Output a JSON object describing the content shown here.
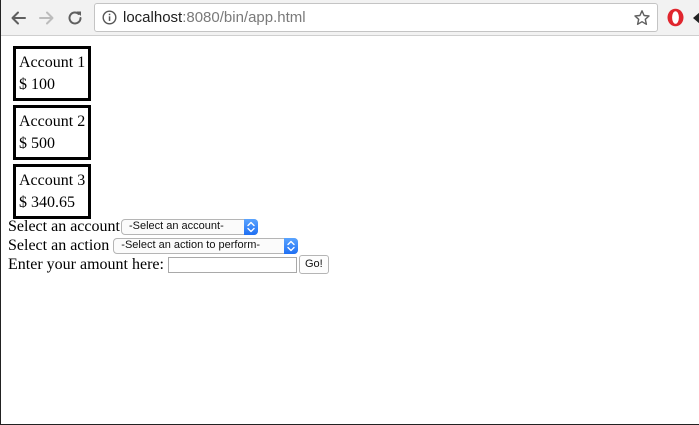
{
  "browser": {
    "url_host": "localhost",
    "url_rest": ":8080/bin/app.html"
  },
  "accounts": [
    {
      "name": "Account 1",
      "balance": "$ 100"
    },
    {
      "name": "Account 2",
      "balance": "$ 500"
    },
    {
      "name": "Account 3",
      "balance": "$ 340.65"
    }
  ],
  "form": {
    "account_label": "Select an account",
    "account_selected": "-Select an account-",
    "action_label": "Select an action",
    "action_selected": "-Select an action to perform-",
    "amount_label": "Enter your amount here:",
    "amount_value": "",
    "go_label": "Go!"
  },
  "colors": {
    "select_stepper": "#2f80f7",
    "opera_red": "#e0262e"
  }
}
